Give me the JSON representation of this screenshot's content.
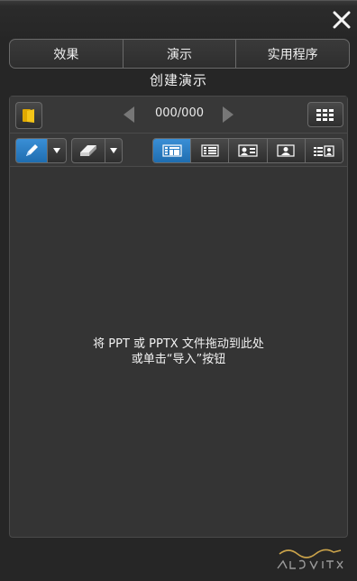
{
  "window": {
    "close_icon": "close-icon"
  },
  "tabs": [
    {
      "label": "效果"
    },
    {
      "label": "演示"
    },
    {
      "label": "实用程序"
    }
  ],
  "section": {
    "title": "创建演示"
  },
  "navigation": {
    "counter": "000/000",
    "open_icon": "folder-open-icon",
    "prev_icon": "prev-arrow-icon",
    "next_icon": "next-arrow-icon",
    "grid_icon": "grid-view-icon"
  },
  "tools": {
    "pen_icon": "pen-icon",
    "eraser_icon": "eraser-icon",
    "views": [
      {
        "icon": "slide-list-view-icon",
        "active": true
      },
      {
        "icon": "list-view-icon",
        "active": false
      },
      {
        "icon": "card-view-icon",
        "active": false
      },
      {
        "icon": "person-view-icon",
        "active": false
      },
      {
        "icon": "list-person-view-icon",
        "active": false
      }
    ]
  },
  "drop_area": {
    "line1": "将 PPT 或 PPTX 文件拖动到此处",
    "line2": "或单击“导入”按钮"
  },
  "colors": {
    "accent": "#2a7fc9",
    "background": "#262626",
    "panel": "#343434"
  }
}
